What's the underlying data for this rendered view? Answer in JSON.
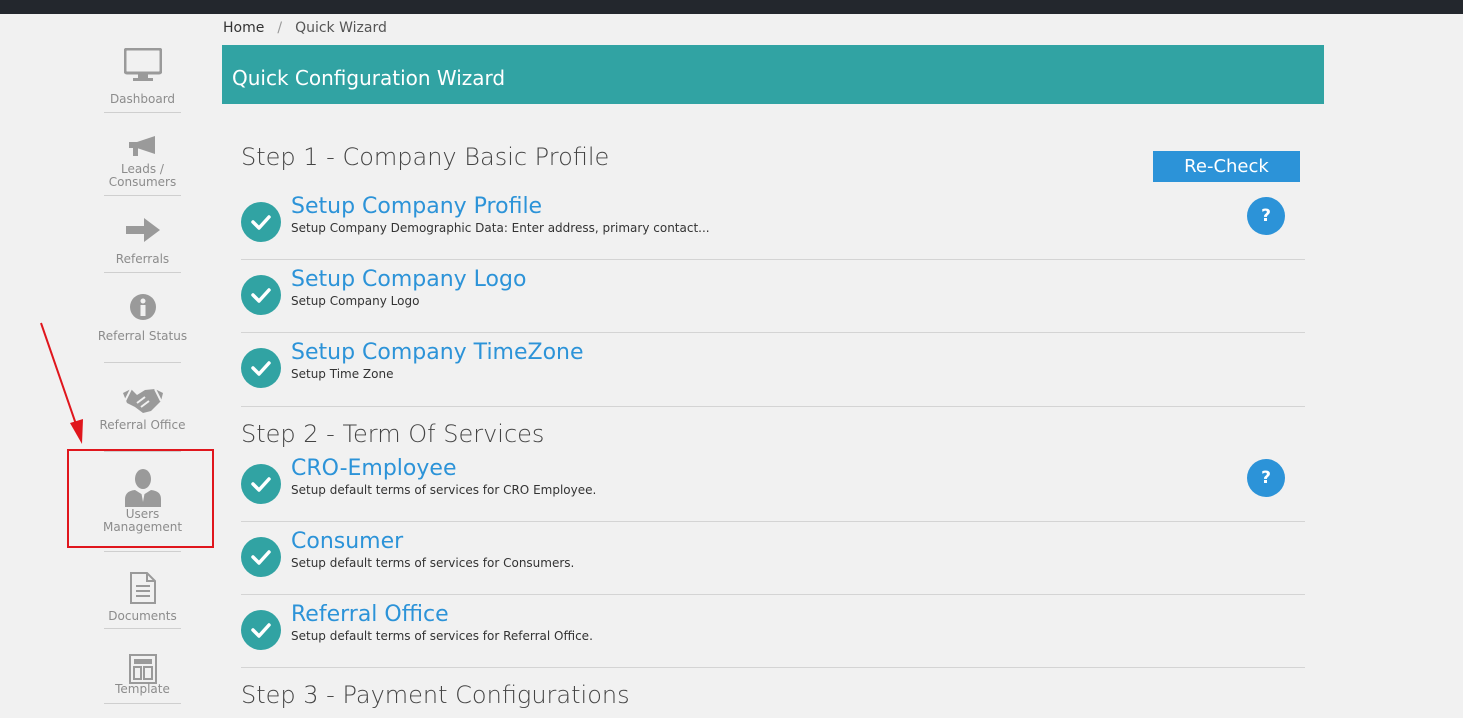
{
  "breadcrumb": {
    "home": "Home",
    "separator": "/",
    "current": "Quick Wizard"
  },
  "banner": {
    "title": "Quick Configuration Wizard"
  },
  "sidebar": {
    "items": [
      {
        "label": "Dashboard",
        "icon": "monitor-icon"
      },
      {
        "label": "Leads / Consumers",
        "icon": "megaphone-icon"
      },
      {
        "label": "Referrals",
        "icon": "arrow-right-icon"
      },
      {
        "label": "Referral Status",
        "icon": "info-icon"
      },
      {
        "label": "Referral Office",
        "icon": "handshake-icon"
      },
      {
        "label": "Users Management",
        "icon": "user-icon"
      },
      {
        "label": "Documents",
        "icon": "document-icon"
      },
      {
        "label": "Template",
        "icon": "template-icon"
      }
    ]
  },
  "recheck_label": "Re-Check",
  "help_label": "?",
  "steps": [
    {
      "title": "Step 1 - Company Basic Profile",
      "tasks": [
        {
          "title": "Setup Company Profile",
          "desc": "Setup Company Demographic Data: Enter address, primary contact..."
        },
        {
          "title": "Setup Company Logo",
          "desc": "Setup Company Logo"
        },
        {
          "title": "Setup Company TimeZone",
          "desc": "Setup Time Zone"
        }
      ]
    },
    {
      "title": "Step 2 - Term Of Services",
      "tasks": [
        {
          "title": "CRO-Employee",
          "desc": "Setup default terms of services for CRO Employee."
        },
        {
          "title": "Consumer",
          "desc": "Setup default terms of services for Consumers."
        },
        {
          "title": "Referral Office",
          "desc": "Setup default terms of services for Referral Office."
        }
      ]
    },
    {
      "title": "Step 3 - Payment Configurations"
    }
  ],
  "colors": {
    "teal": "#31a3a3",
    "blue": "#2c93d8",
    "annotation_red": "#e0161d",
    "topbar": "#23272d"
  }
}
